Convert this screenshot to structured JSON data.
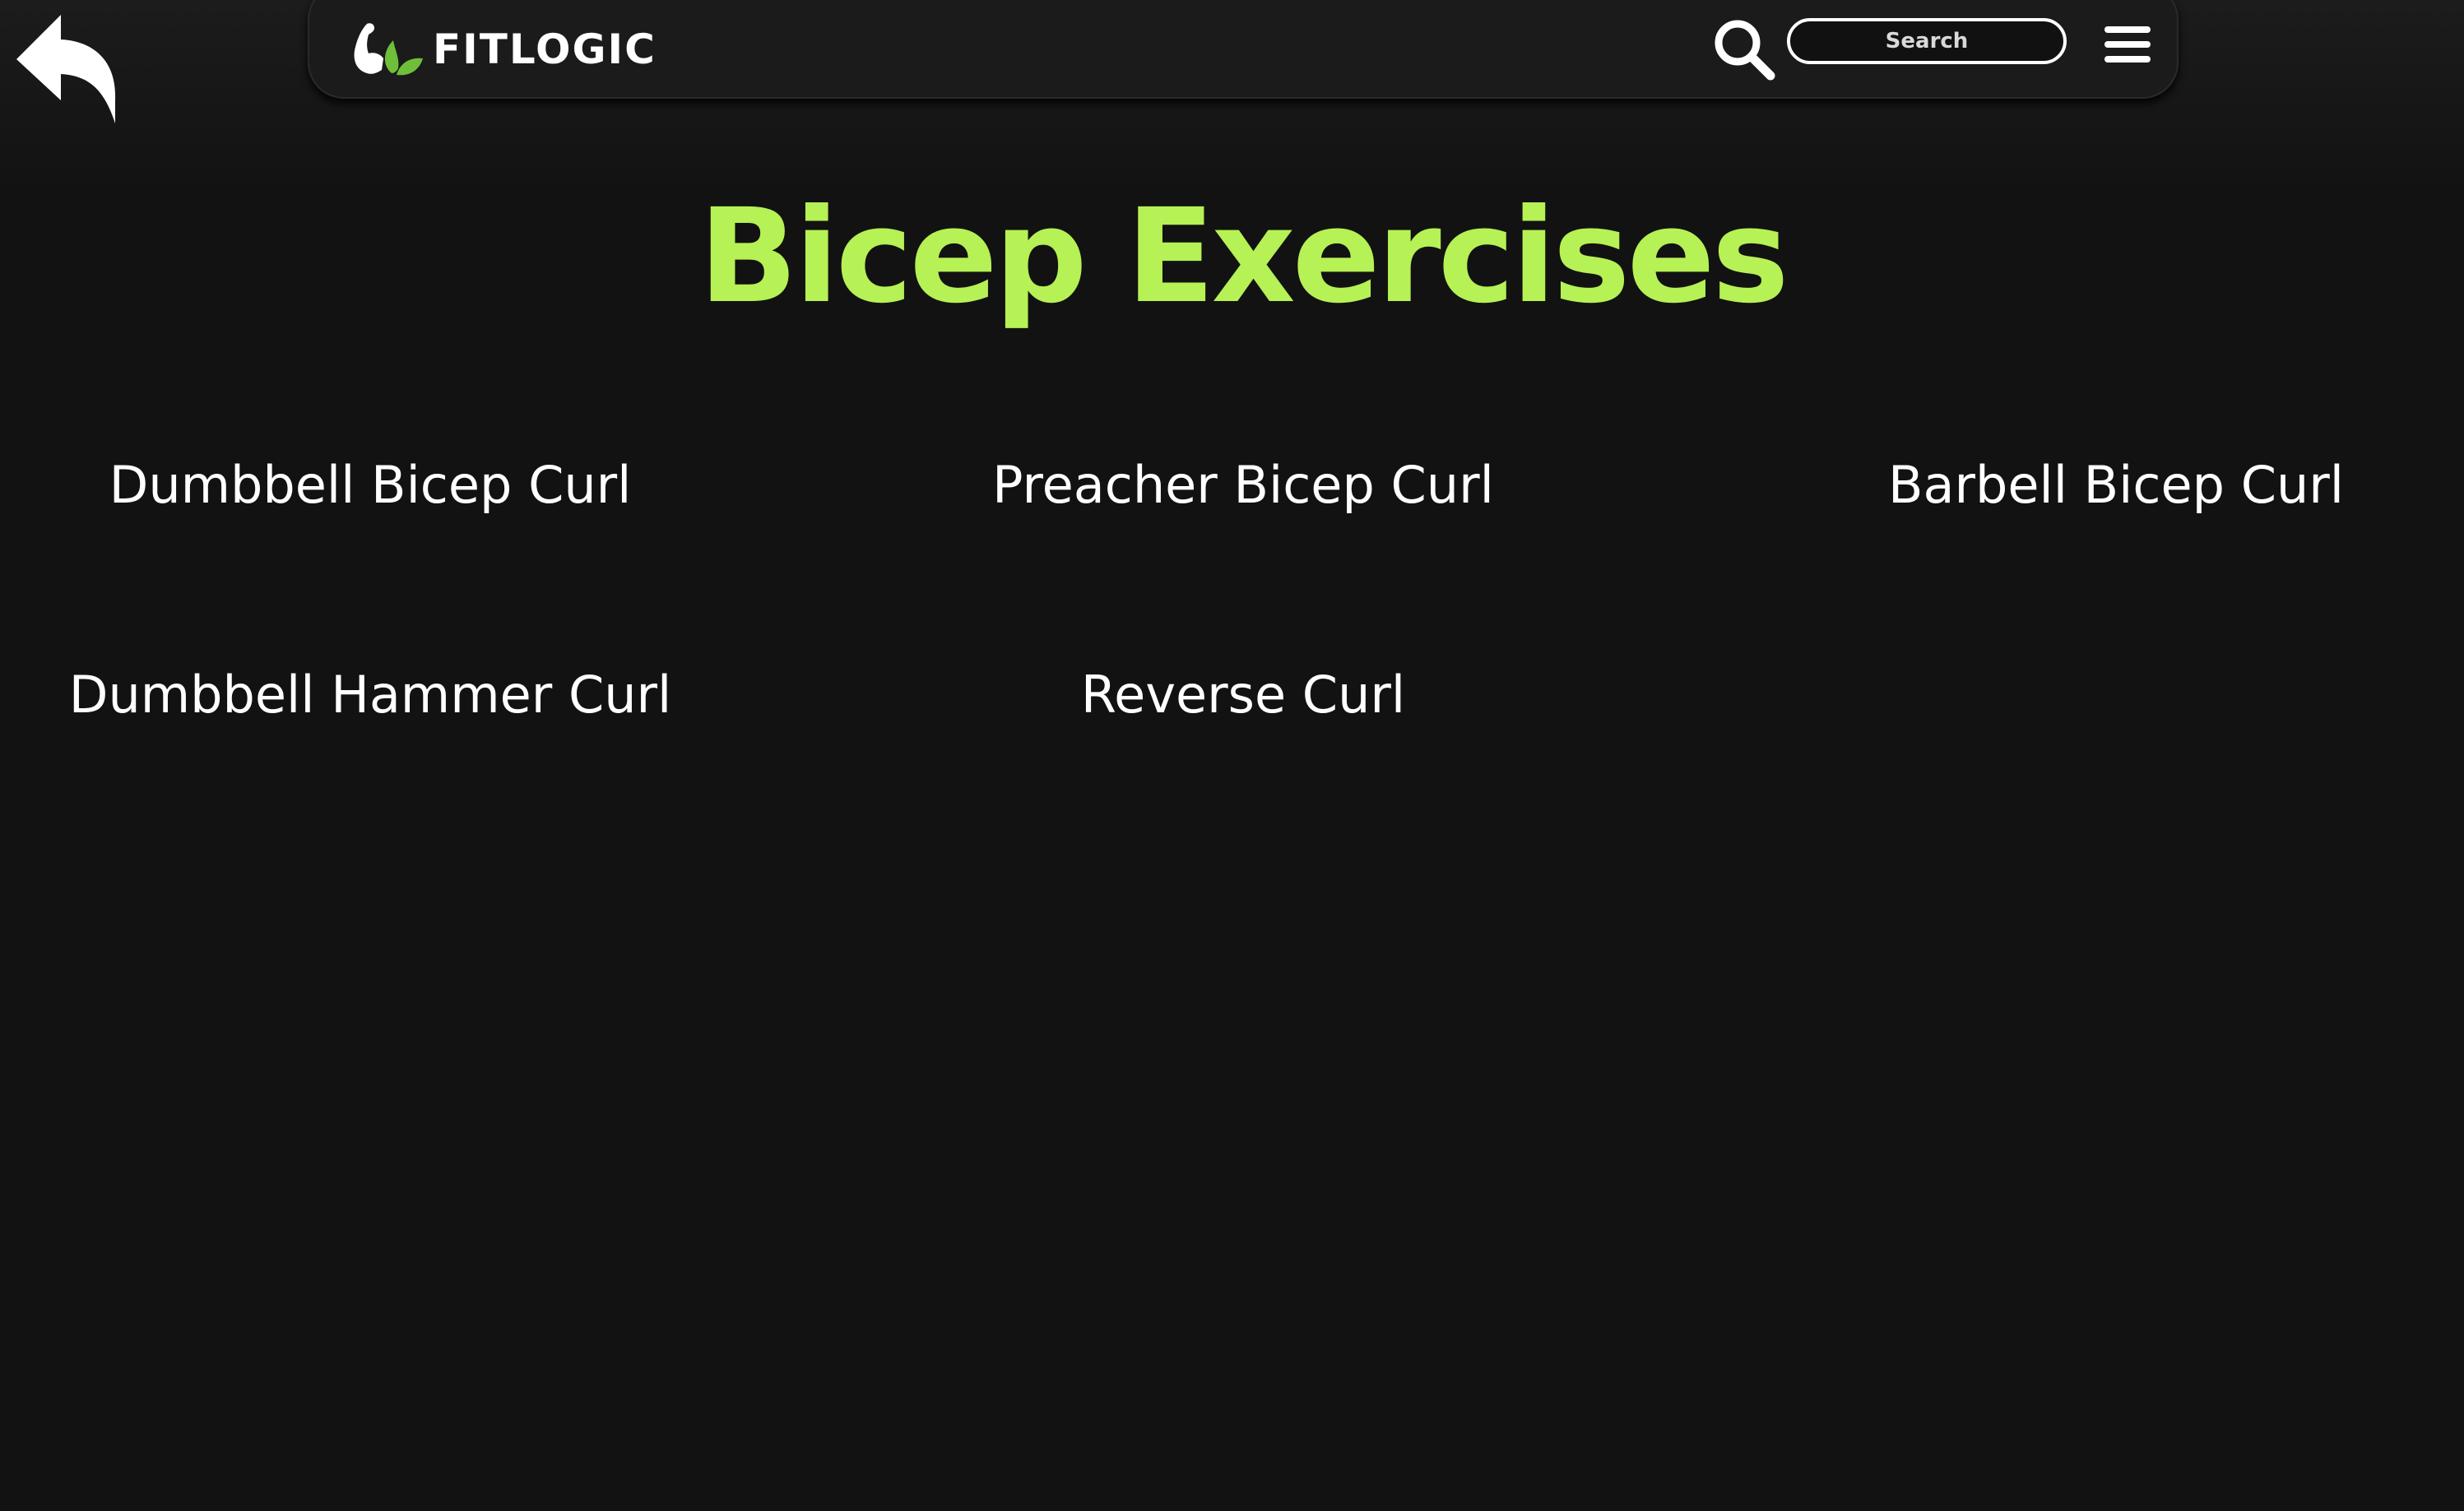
{
  "header": {
    "brand_name": "FITLOGIC",
    "logo_icon": "flexed-arm-leaf-logo",
    "back_icon": "reply-arrow-icon",
    "search_icon": "magnifier-icon",
    "menu_icon": "hamburger-icon",
    "search_placeholder": "Search"
  },
  "main": {
    "title": "Bicep Exercises",
    "exercises": [
      "Dumbbell Bicep Curl",
      "Preacher Bicep Curl",
      "Barbell Bicep Curl",
      "Dumbbell Hammer Curl",
      "Reverse Curl"
    ]
  },
  "colors": {
    "background": "#121212",
    "navbar": "#1b1b1b",
    "accent": "#b6f155",
    "leaf_green": "#6fbf3a",
    "text": "#ffffff"
  }
}
